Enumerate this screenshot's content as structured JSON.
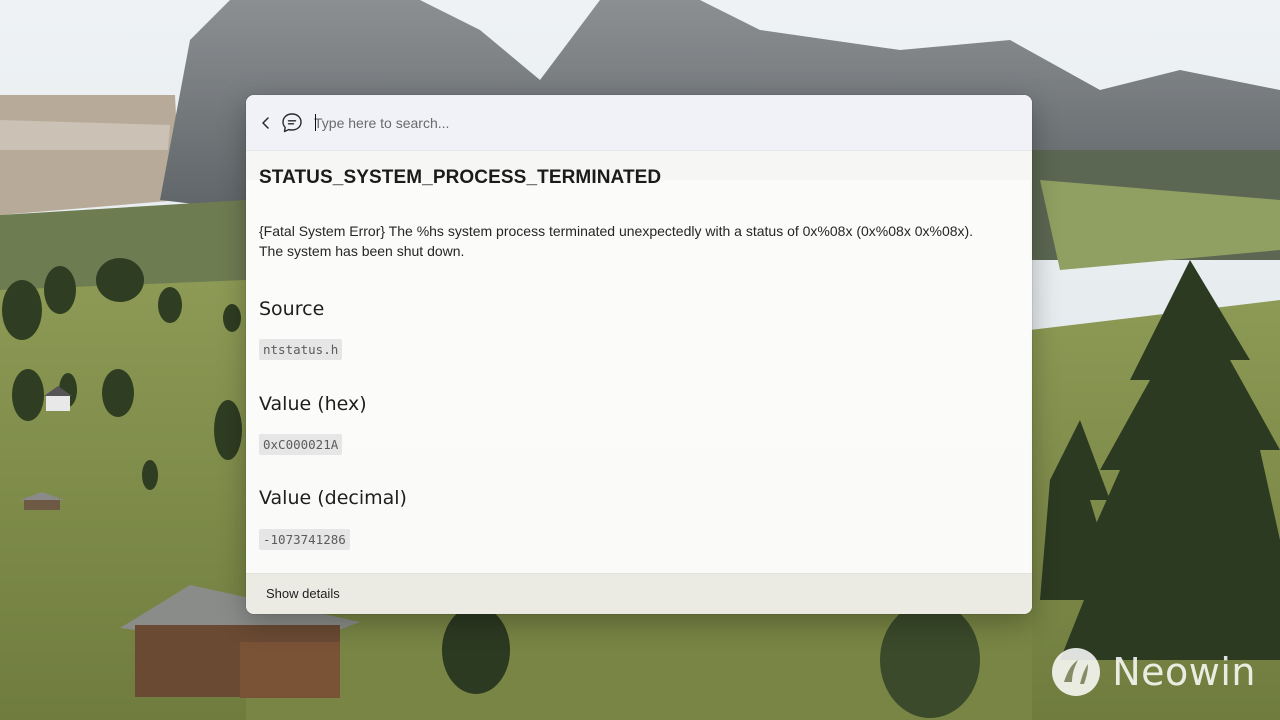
{
  "search": {
    "placeholder": "Type here to search...",
    "value": ""
  },
  "error": {
    "name": "STATUS_SYSTEM_PROCESS_TERMINATED",
    "description": "{Fatal System Error} The %hs system process terminated unexpectedly with a status of 0x%08x (0x%08x 0x%08x). The system has been shut down."
  },
  "sections": {
    "source": {
      "heading": "Source",
      "value": "ntstatus.h"
    },
    "value_hex": {
      "heading": "Value (hex)",
      "value": "0xC000021A"
    },
    "value_decimal": {
      "heading": "Value (decimal)",
      "value": "-1073741286"
    }
  },
  "footer": {
    "show_details_label": "Show details"
  },
  "watermark": {
    "text": "Neowin"
  },
  "icons": {
    "back": "chevron-left-icon",
    "chat": "chat-bubble-icon",
    "watermark": "neowin-logo-icon"
  },
  "colors": {
    "panel_bg": "#fbfbf9",
    "search_bar_bg": "#f1f2f8",
    "footer_bg": "#ebebe4",
    "code_bg": "#e6e6e6"
  }
}
